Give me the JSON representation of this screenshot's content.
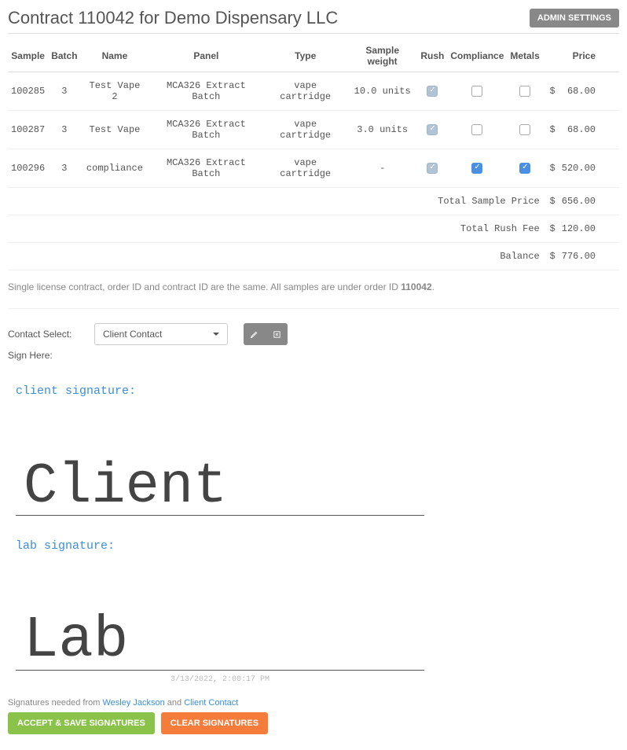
{
  "header": {
    "title": "Contract 110042 for Demo Dispensary LLC",
    "admin_btn": "ADMIN SETTINGS"
  },
  "table": {
    "headers": {
      "sample": "Sample",
      "batch": "Batch",
      "name": "Name",
      "panel": "Panel",
      "type": "Type",
      "weight": "Sample weight",
      "rush": "Rush",
      "compliance": "Compliance",
      "metals": "Metals",
      "price": "Price"
    },
    "rows": [
      {
        "sample": "100285",
        "batch": "3",
        "name": "Test Vape 2",
        "panel": "MCA326 Extract Batch",
        "type": "vape cartridge",
        "weight": "10.0 units",
        "rush": true,
        "compliance": false,
        "metals": false,
        "currency": "$",
        "price": "68.00"
      },
      {
        "sample": "100287",
        "batch": "3",
        "name": "Test Vape",
        "panel": "MCA326 Extract Batch",
        "type": "vape cartridge",
        "weight": "3.0 units",
        "rush": true,
        "compliance": false,
        "metals": false,
        "currency": "$",
        "price": "68.00"
      },
      {
        "sample": "100296",
        "batch": "3",
        "name": "compliance",
        "panel": "MCA326 Extract Batch",
        "type": "vape cartridge",
        "weight": "-",
        "rush": true,
        "compliance": true,
        "metals": true,
        "currency": "$",
        "price": "520.00"
      }
    ],
    "totals": [
      {
        "label": "Total Sample Price",
        "currency": "$",
        "value": "656.00"
      },
      {
        "label": "Total Rush Fee",
        "currency": "$",
        "value": "120.00"
      },
      {
        "label": "Balance",
        "currency": "$",
        "value": "776.00"
      }
    ]
  },
  "note_prefix": "Single license contract, order ID and contract ID are the same. All samples are under order ID ",
  "note_bold": "110042",
  "note_suffix": ".",
  "contact": {
    "label": "Contact Select:",
    "selected": "Client Contact",
    "sign_here": "Sign Here:"
  },
  "signatures": {
    "client_label": "client signature:",
    "client_text": "Client",
    "lab_label": "lab signature:",
    "lab_text": "Lab",
    "timestamp": "3/13/2022, 2:00:17 PM"
  },
  "sig_note": {
    "prefix": "Signatures needed from ",
    "link1": "Wesley Jackson",
    "mid": " and ",
    "link2": "Client Contact"
  },
  "buttons": {
    "accept": "ACCEPT & SAVE SIGNATURES",
    "clear": "CLEAR SIGNATURES"
  }
}
